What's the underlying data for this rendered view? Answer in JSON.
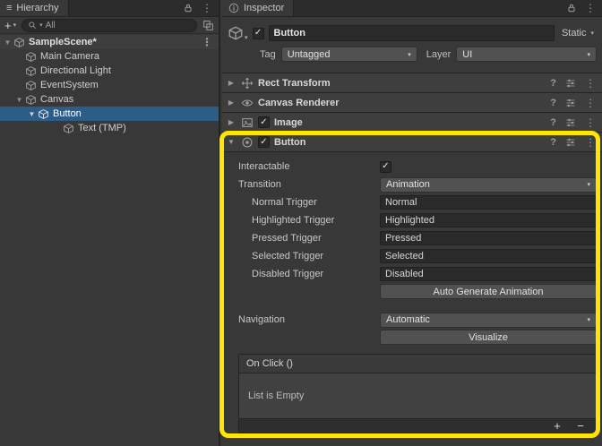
{
  "icons": {
    "menu": "≡",
    "kebab": "⋮",
    "caret_down": "▾",
    "tri_expanded": "▼",
    "tri_collapsed": "▶",
    "check": "✓",
    "help": "?"
  },
  "colors": {
    "selection": "#2d5c87",
    "annotation": "#ffe600"
  },
  "hierarchy": {
    "tab": "Hierarchy",
    "toolbar": {
      "add": "+",
      "search_label": "All"
    },
    "tree": [
      {
        "label": "SampleScene*"
      },
      {
        "label": "Main Camera"
      },
      {
        "label": "Directional Light"
      },
      {
        "label": "EventSystem"
      },
      {
        "label": "Canvas"
      },
      {
        "label": "Button"
      },
      {
        "label": "Text (TMP)"
      }
    ]
  },
  "inspector": {
    "tab": "Inspector",
    "gameobject": {
      "name": "Button",
      "static_label": "Static",
      "tag_label": "Tag",
      "tag_value": "Untagged",
      "layer_label": "Layer",
      "layer_value": "UI"
    },
    "components": [
      {
        "name": "Rect Transform"
      },
      {
        "name": "Canvas Renderer"
      },
      {
        "name": "Image"
      },
      {
        "name": "Button"
      }
    ],
    "button_component": {
      "interactable_label": "Interactable",
      "transition_label": "Transition",
      "transition_value": "Animation",
      "triggers": [
        {
          "label": "Normal Trigger",
          "value": "Normal"
        },
        {
          "label": "Highlighted Trigger",
          "value": "Highlighted"
        },
        {
          "label": "Pressed Trigger",
          "value": "Pressed"
        },
        {
          "label": "Selected Trigger",
          "value": "Selected"
        },
        {
          "label": "Disabled Trigger",
          "value": "Disabled"
        }
      ],
      "auto_generate_button": "Auto Generate Animation",
      "navigation_label": "Navigation",
      "navigation_value": "Automatic",
      "visualize_button": "Visualize",
      "on_click": {
        "title": "On Click ()",
        "empty": "List is Empty",
        "add": "+",
        "remove": "−"
      }
    }
  }
}
